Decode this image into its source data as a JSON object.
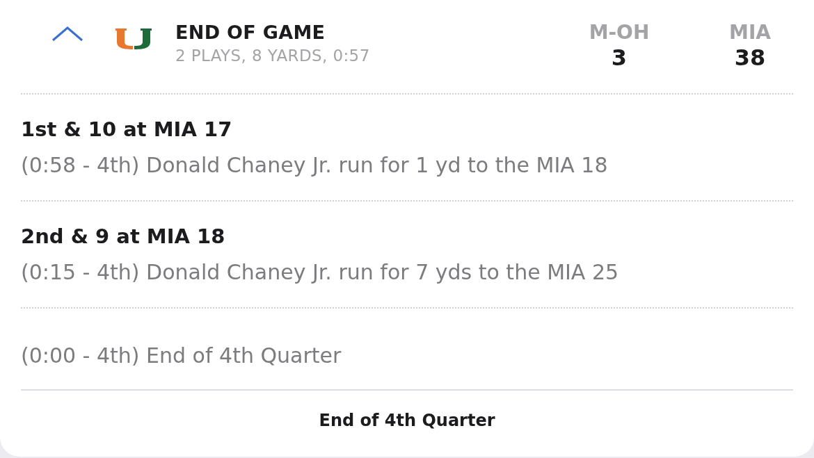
{
  "drive": {
    "expanded": true,
    "title": "END OF GAME",
    "summary": "2 PLAYS, 8 YARDS, 0:57",
    "scores": [
      {
        "team": "M-OH",
        "score": "3"
      },
      {
        "team": "MIA",
        "score": "38"
      }
    ]
  },
  "plays": [
    {
      "down": "1st & 10 at MIA 17",
      "text": "(0:58 - 4th) Donald Chaney Jr. run for 1 yd to the MIA 18"
    },
    {
      "down": "2nd & 9 at MIA 18",
      "text": "(0:15 - 4th) Donald Chaney Jr. run for 7 yds to the MIA 25"
    },
    {
      "text": "(0:00 - 4th) End of 4th Quarter"
    }
  ],
  "footer": "End of 4th Quarter"
}
